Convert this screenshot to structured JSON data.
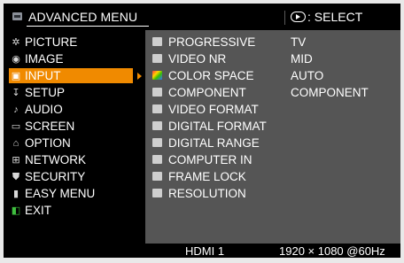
{
  "header": {
    "title": "ADVANCED MENU",
    "select_label": ": SELECT",
    "menu_icon": "menu-icon",
    "select_icon": "enter-button-icon"
  },
  "left_menu": {
    "items": [
      {
        "label": "PICTURE",
        "icon": "picture-sun-icon"
      },
      {
        "label": "IMAGE",
        "icon": "image-icon"
      },
      {
        "label": "INPUT",
        "icon": "input-icon",
        "selected": true
      },
      {
        "label": "SETUP",
        "icon": "setup-icon"
      },
      {
        "label": "AUDIO",
        "icon": "audio-note-icon"
      },
      {
        "label": "SCREEN",
        "icon": "screen-icon"
      },
      {
        "label": "OPTION",
        "icon": "option-icon"
      },
      {
        "label": "NETWORK",
        "icon": "network-icon"
      },
      {
        "label": "SECURITY",
        "icon": "shield-icon"
      },
      {
        "label": "EASY MENU",
        "icon": "easy-menu-icon"
      },
      {
        "label": "EXIT",
        "icon": "exit-icon"
      }
    ]
  },
  "input_menu": {
    "items": [
      {
        "label": "PROGRESSIVE",
        "value": "TV",
        "icon": "progressive-icon"
      },
      {
        "label": "VIDEO NR",
        "value": "MID",
        "icon": "video-nr-icon"
      },
      {
        "label": "COLOR SPACE",
        "value": "AUTO",
        "icon": "color-space-icon"
      },
      {
        "label": "COMPONENT",
        "value": "COMPONENT",
        "icon": "component-icon"
      },
      {
        "label": "VIDEO FORMAT",
        "value": "",
        "icon": "video-format-icon"
      },
      {
        "label": "DIGITAL FORMAT",
        "value": "",
        "icon": "digital-format-icon"
      },
      {
        "label": "DIGITAL RANGE",
        "value": "",
        "icon": "digital-range-icon"
      },
      {
        "label": "COMPUTER IN",
        "value": "",
        "icon": "computer-in-icon"
      },
      {
        "label": "FRAME LOCK",
        "value": "",
        "icon": "frame-lock-icon"
      },
      {
        "label": "RESOLUTION",
        "value": "",
        "icon": "resolution-icon"
      }
    ]
  },
  "footer": {
    "source": "HDMI 1",
    "resolution": "1920 × 1080 @60Hz"
  },
  "colors": {
    "highlight": "#f08a00",
    "pane": "#555555",
    "background": "#000000"
  }
}
